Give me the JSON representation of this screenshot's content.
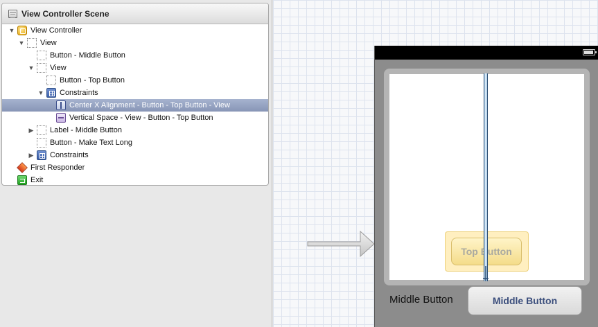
{
  "outline": {
    "header_title": "View Controller Scene",
    "rows": [
      {
        "label": "View Controller",
        "icon": "view-controller-icon",
        "expanded": true
      },
      {
        "label": "View",
        "icon": "view-icon",
        "expanded": true
      },
      {
        "label": "Button - Middle Button",
        "icon": "view-icon"
      },
      {
        "label": "View",
        "icon": "view-icon",
        "expanded": true
      },
      {
        "label": "Button - Top Button",
        "icon": "view-icon"
      },
      {
        "label": "Constraints",
        "icon": "constraints-icon",
        "expanded": true
      },
      {
        "label": "Center X Alignment - Button - Top Button - View",
        "icon": "center-x-constraint-icon",
        "selected": true
      },
      {
        "label": "Vertical Space - View - Button - Top Button",
        "icon": "vertical-space-constraint-icon"
      },
      {
        "label": "Label - Middle Button",
        "icon": "view-icon",
        "expanded": false
      },
      {
        "label": "Button - Make Text Long",
        "icon": "view-icon"
      },
      {
        "label": "Constraints",
        "icon": "constraints-icon",
        "expanded": false
      },
      {
        "label": "First Responder",
        "icon": "first-responder-icon"
      },
      {
        "label": "Exit",
        "icon": "exit-icon"
      }
    ]
  },
  "canvas": {
    "top_button_label": "Top Button",
    "middle_label_text": "Middle Button",
    "middle_button_label": "Middle Button"
  },
  "colors": {
    "selection": "#8f9dbd",
    "canvas_grid": "#dde3ee",
    "device_background": "#8c8c8c",
    "button_text": "#3b4e7c"
  }
}
